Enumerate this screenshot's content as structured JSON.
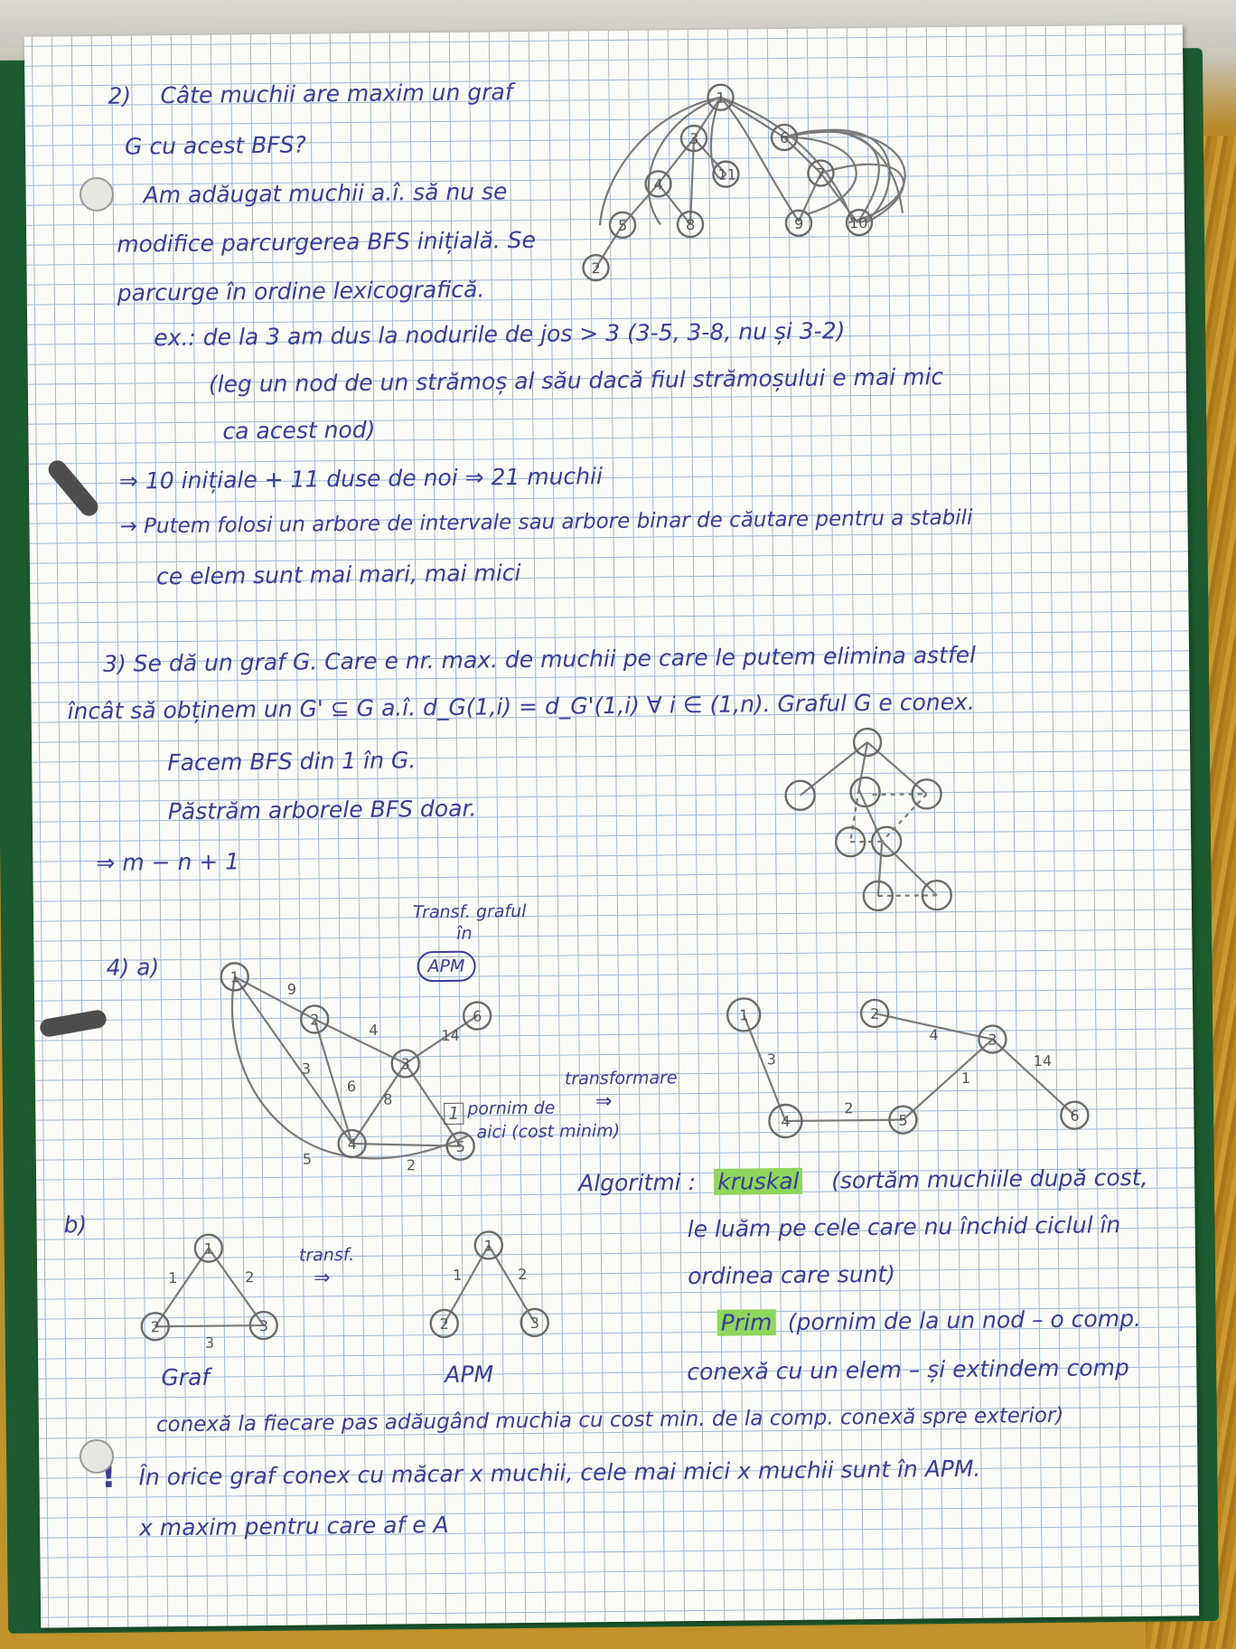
{
  "problem2": {
    "title": "2)",
    "line1": "Câte muchii are maxim un graf",
    "line2": "G cu acest BFS?",
    "line3": "Am adăugat muchii a.î. să nu se",
    "line4": "modifice parcurgerea BFS inițială. Se",
    "line5": "parcurge în ordine lexicografică.",
    "line6": "ex.: de la 3 am dus la nodurile de jos > 3  (3-5, 3-8, nu și 3-2)",
    "line7": "(leg un nod de un strămoș al său dacă fiul strămoșului e mai mic",
    "line8": "ca acest nod)",
    "line9": "⇒   10 inițiale + 11 duse de noi    ⇒ 21 muchii",
    "line10": "→ Putem folosi un arbore de intervale sau arbore binar de căutare pentru a stabili",
    "line11": "ce elem sunt mai mari, mai mici",
    "tree_nodes": [
      "1",
      "3",
      "6",
      "4",
      "11",
      "7",
      "5",
      "8",
      "9",
      "10",
      "2"
    ]
  },
  "problem3": {
    "line1": "3)  Se dă un graf G. Care e nr. max. de muchii pe care le putem elimina astfel",
    "line2": "încât să obținem un G' ⊆ G a.î.  d_G(1,i) = d_G'(1,i)   ∀ i ∈ (1,n). Graful G e conex.",
    "line3": "Facem BFS din 1 în G.",
    "line4": "Păstrăm arborele BFS doar.",
    "line5": "⇒   m − n + 1"
  },
  "problem4": {
    "a_label": "4)  a)",
    "transf_note1": "Transf. graful",
    "transf_note2": "în",
    "apm": "APM",
    "transformare": "transformare",
    "pornim_note1": "pornim de",
    "pornim_note2": "aici (cost minim)",
    "pornim_node": "1",
    "graph_a": {
      "nodes": [
        "1",
        "2",
        "3",
        "4",
        "5",
        "6"
      ],
      "weights": [
        "9",
        "3",
        "4",
        "6",
        "8",
        "14",
        "5",
        "2"
      ]
    },
    "apm_a": {
      "nodes": [
        "1",
        "2",
        "3",
        "4",
        "5",
        "6"
      ],
      "weights": [
        "3",
        "4",
        "2",
        "14",
        "1"
      ]
    },
    "algoritmi_label": "Algoritmi :",
    "kruskal": "kruskal",
    "kruskal_desc1": "(sortăm muchiile după cost,",
    "kruskal_desc2": "le luăm pe cele care nu închid ciclul în",
    "kruskal_desc3": "ordinea care sunt)",
    "prim": "Prim",
    "prim_desc1": "(pornim de la un nod – o comp.",
    "prim_desc2": "conexă cu un elem – și extindem comp",
    "prim_desc3": "conexă la fiecare pas adăugând muchia cu cost min. de la comp. conexă spre exterior)",
    "b_label": "b)",
    "transf_short": "transf.",
    "graf_label": "Graf",
    "apm_label": "APM",
    "graph_b": {
      "nodes": [
        "1",
        "2",
        "3"
      ],
      "weights": [
        "1",
        "2",
        "3"
      ]
    },
    "apm_b": {
      "nodes": [
        "1",
        "2",
        "3"
      ],
      "weights": [
        "1",
        "2"
      ]
    },
    "exclaim": "!",
    "note1": "În orice graf conex cu măcar x muchii, cele mai mici x muchii sunt în APM.",
    "note2": "x maxim pentru care af e A"
  }
}
